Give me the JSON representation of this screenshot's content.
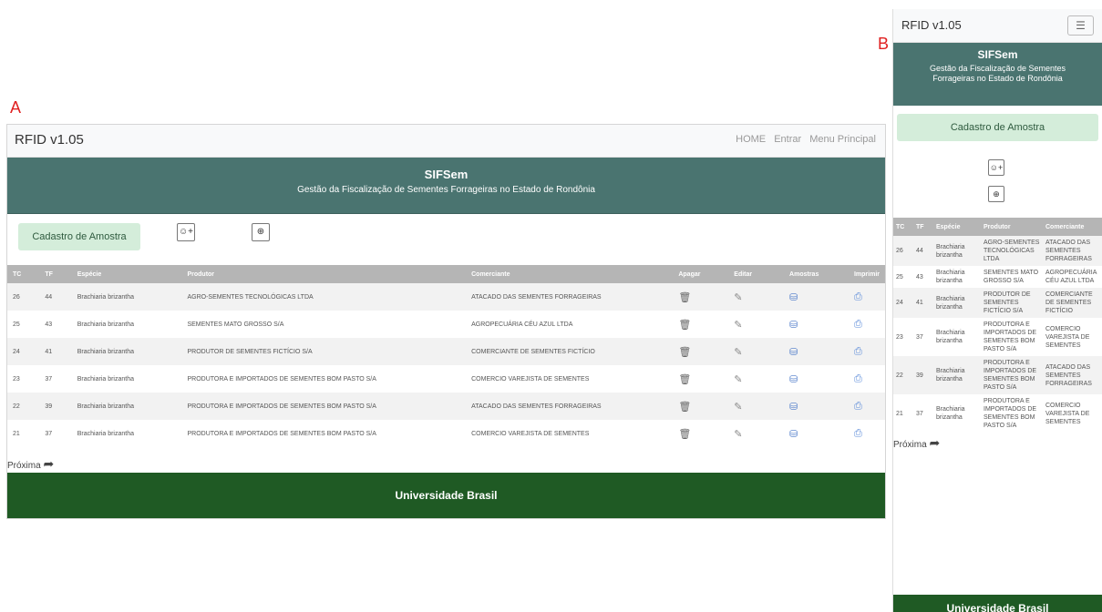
{
  "labels": {
    "panel_a": "A",
    "panel_b": "B"
  },
  "app": {
    "brand": "RFID v1.05",
    "nav_links": [
      "HOME",
      "Entrar",
      "Menu Principal"
    ],
    "title": "SIFSem",
    "subtitle": "Gestão da Fiscalização de Sementes Forrageiras no Estado de Rondônia",
    "cadastro_button": "Cadastro de Amostra",
    "next_label": "Próxima",
    "footer": "Universidade Brasil"
  },
  "icons": {
    "add_user": "add-user-icon",
    "search": "zoom-in-icon",
    "delete": "trash-icon",
    "edit": "pencil-icon",
    "samples": "database-icon",
    "print": "printer-icon",
    "next": "share-arrow-icon",
    "menu": "hamburger-icon"
  },
  "colors": {
    "header": "#4a7470",
    "footer": "#1f5a24",
    "cadastro": "#d4edda",
    "table_header": "#b5b5b5",
    "label": "#e02020"
  },
  "table": {
    "headers": [
      "TC",
      "TF",
      "Espécie",
      "Produtor",
      "Comerciante",
      "Apagar",
      "Editar",
      "Amostras",
      "Imprimir"
    ],
    "rows": [
      {
        "tc": "26",
        "tf": "44",
        "especie": "Brachiaria brizantha",
        "produtor": "AGRO-SEMENTES TECNOLÓGICAS LTDA",
        "comerciante": "ATACADO DAS SEMENTES FORRAGEIRAS"
      },
      {
        "tc": "25",
        "tf": "43",
        "especie": "Brachiaria brizantha",
        "produtor": "SEMENTES MATO GROSSO S/A",
        "comerciante": "AGROPECUÁRIA CÉU AZUL LTDA"
      },
      {
        "tc": "24",
        "tf": "41",
        "especie": "Brachiaria brizantha",
        "produtor": "PRODUTOR DE SEMENTES FICTÍCIO S/A",
        "comerciante": "COMERCIANTE DE SEMENTES FICTÍCIO"
      },
      {
        "tc": "23",
        "tf": "37",
        "especie": "Brachiaria brizantha",
        "produtor": "PRODUTORA E IMPORTADOS DE SEMENTES BOM PASTO S/A",
        "comerciante": "COMERCIO VAREJISTA DE SEMENTES"
      },
      {
        "tc": "22",
        "tf": "39",
        "especie": "Brachiaria brizantha",
        "produtor": "PRODUTORA E IMPORTADOS DE SEMENTES BOM PASTO S/A",
        "comerciante": "ATACADO DAS SEMENTES FORRAGEIRAS"
      },
      {
        "tc": "21",
        "tf": "37",
        "especie": "Brachiaria brizantha",
        "produtor": "PRODUTORA E IMPORTADOS DE SEMENTES BOM PASTO S/A",
        "comerciante": "COMERCIO VAREJISTA DE SEMENTES"
      }
    ]
  }
}
